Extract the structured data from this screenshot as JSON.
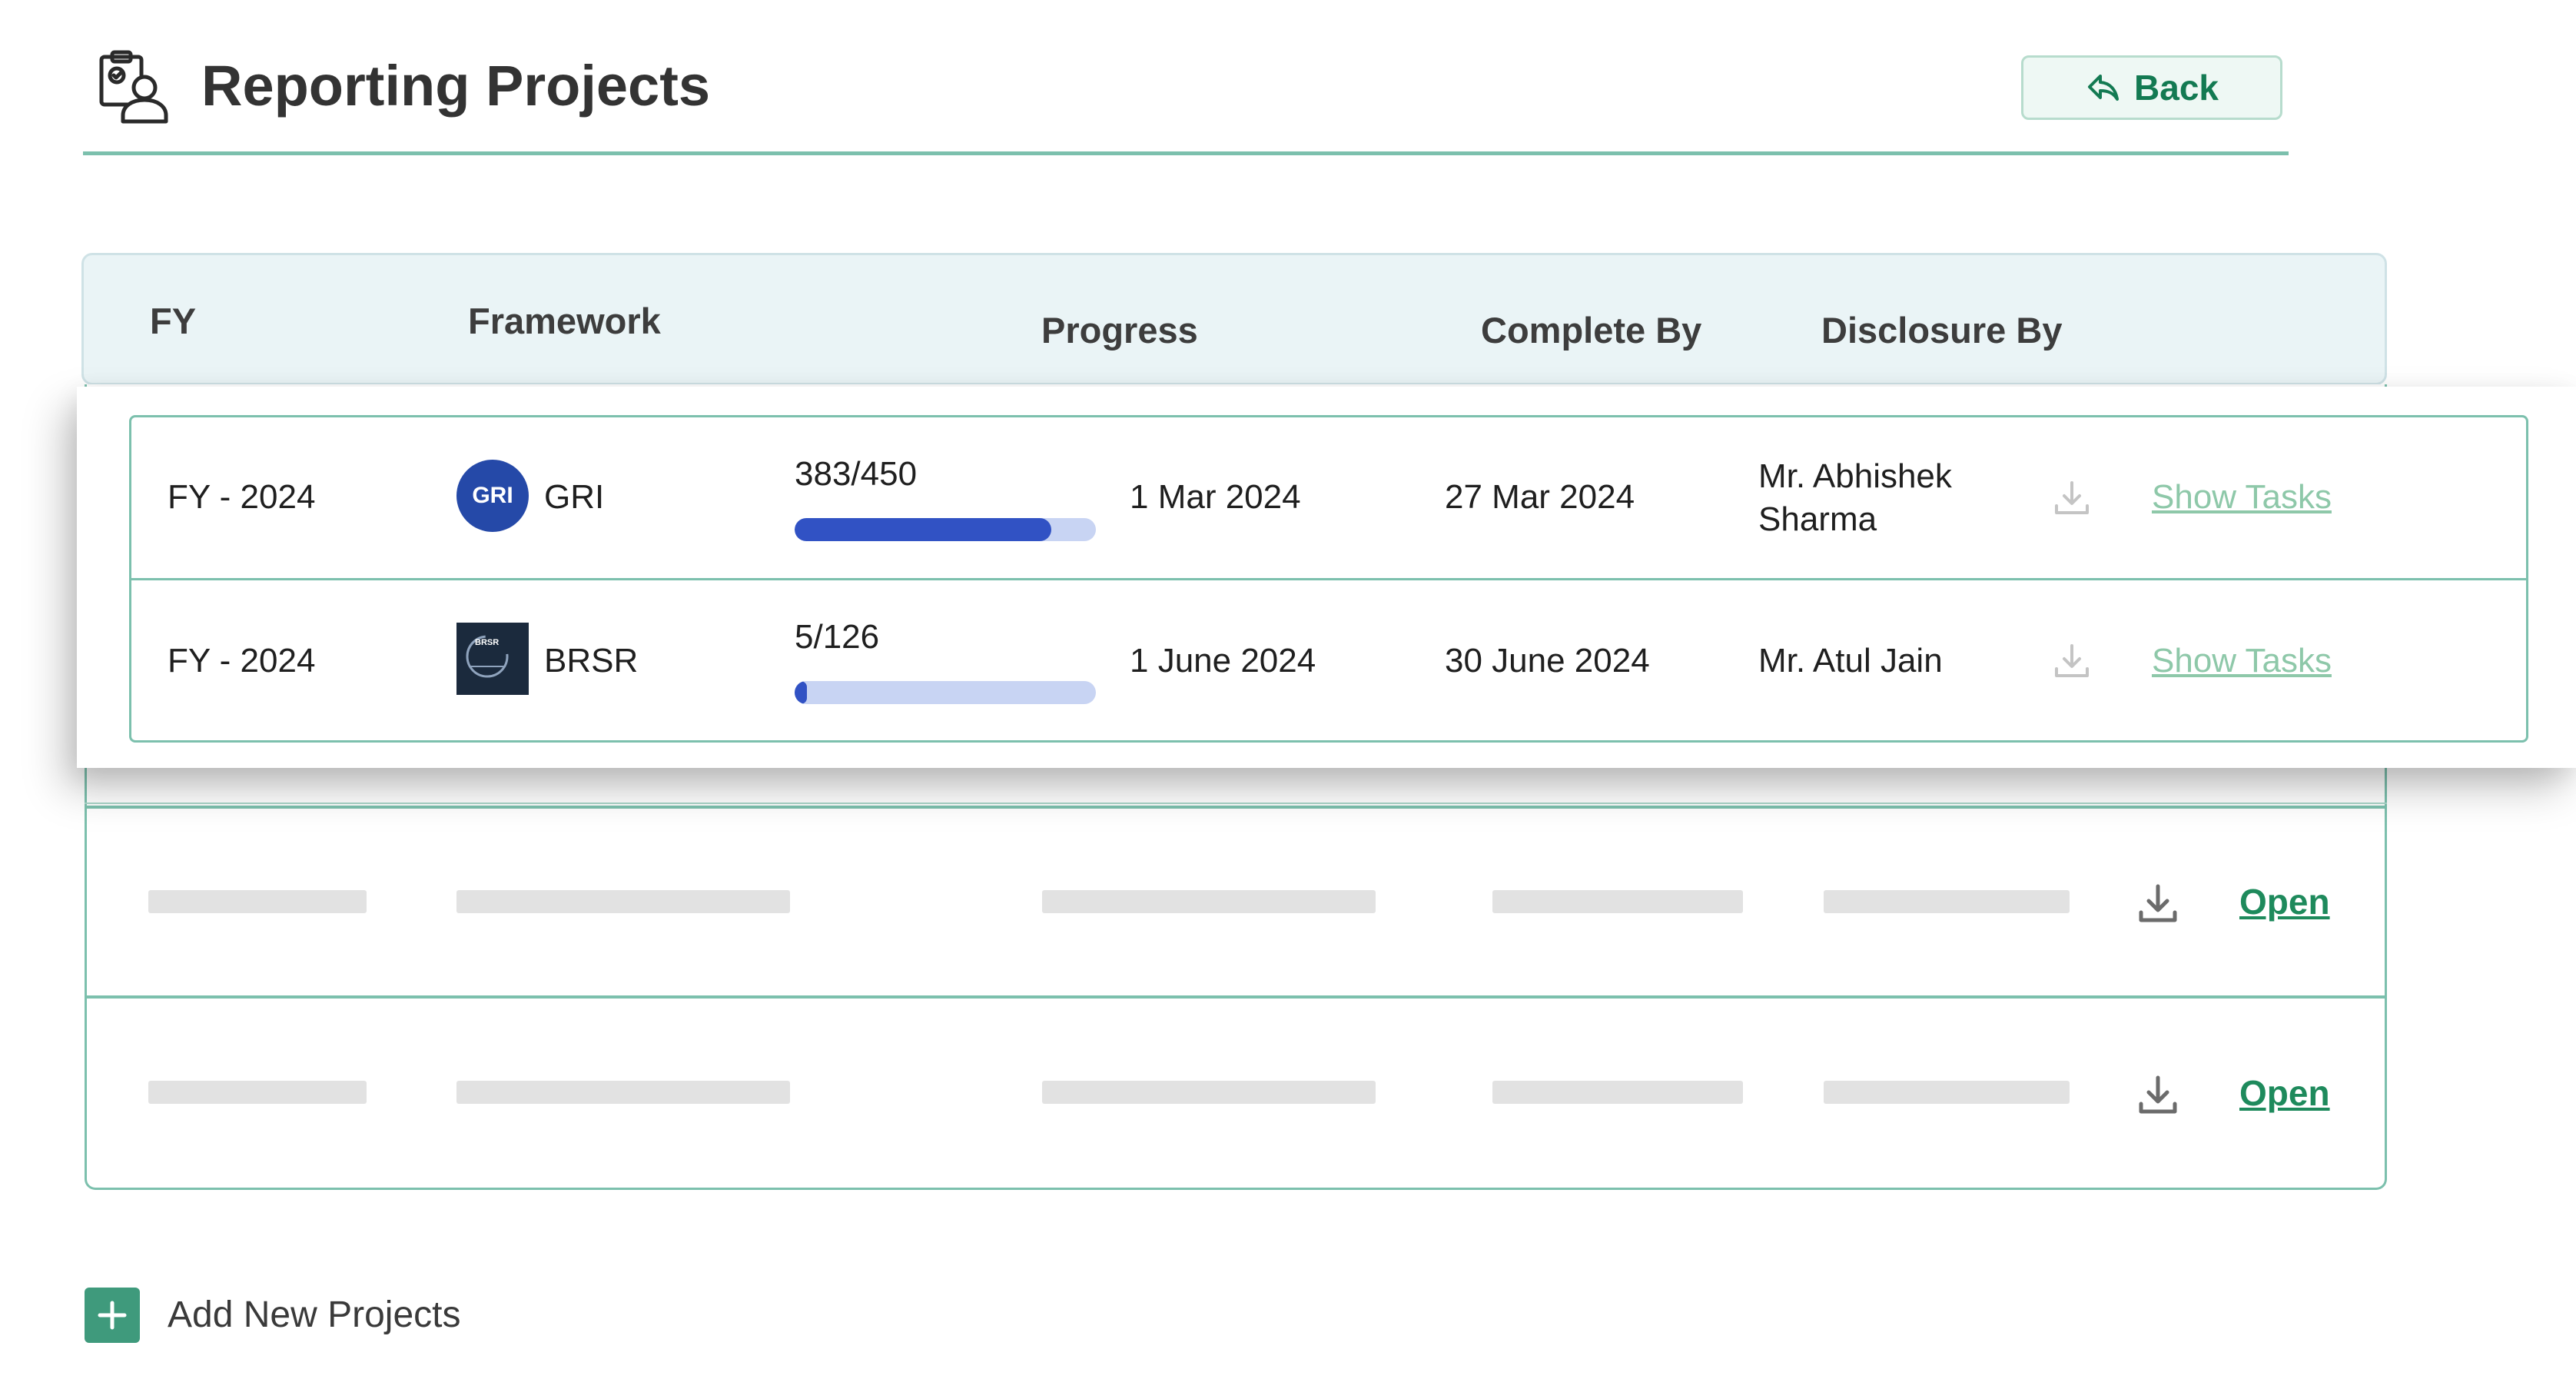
{
  "header": {
    "title": "Reporting Projects",
    "back_label": "Back"
  },
  "table": {
    "columns": [
      "FY",
      "Framework",
      "Progress",
      "Complete By",
      "Disclosure By"
    ]
  },
  "rows": [
    {
      "fy": "FY - 2024",
      "framework_logo": "GRI",
      "framework": "GRI",
      "progress_text": "383/450",
      "progress_done": 383,
      "progress_total": 450,
      "date_1": "1 Mar 2024",
      "date_2": "27 Mar 2024",
      "person_line1": "Mr. Abhishek",
      "person_line2": "Sharma",
      "link": "Show Tasks"
    },
    {
      "fy": "FY - 2024",
      "framework_logo": "BRSR",
      "framework": "BRSR",
      "progress_text": "5/126",
      "progress_done": 5,
      "progress_total": 126,
      "date_1": "1 June 2024",
      "date_2": "30 June 2024",
      "person_line1": "Mr. Atul Jain",
      "link": "Show Tasks"
    }
  ],
  "placeholder_rows": [
    {
      "link": "Open"
    },
    {
      "link": "Open"
    }
  ],
  "add_label": "Add New Projects",
  "icons": {
    "header": "reporting-projects-icon",
    "back": "reply-arrow-icon",
    "download": "download-icon",
    "add": "plus-icon"
  },
  "colors": {
    "accent": "#7cc0ad",
    "progress_fill": "#3152c4",
    "progress_track": "#c8d4f3",
    "link_green": "#1e8a5c",
    "link_light": "#8ec8a9",
    "add_button": "#3f9a7c"
  }
}
